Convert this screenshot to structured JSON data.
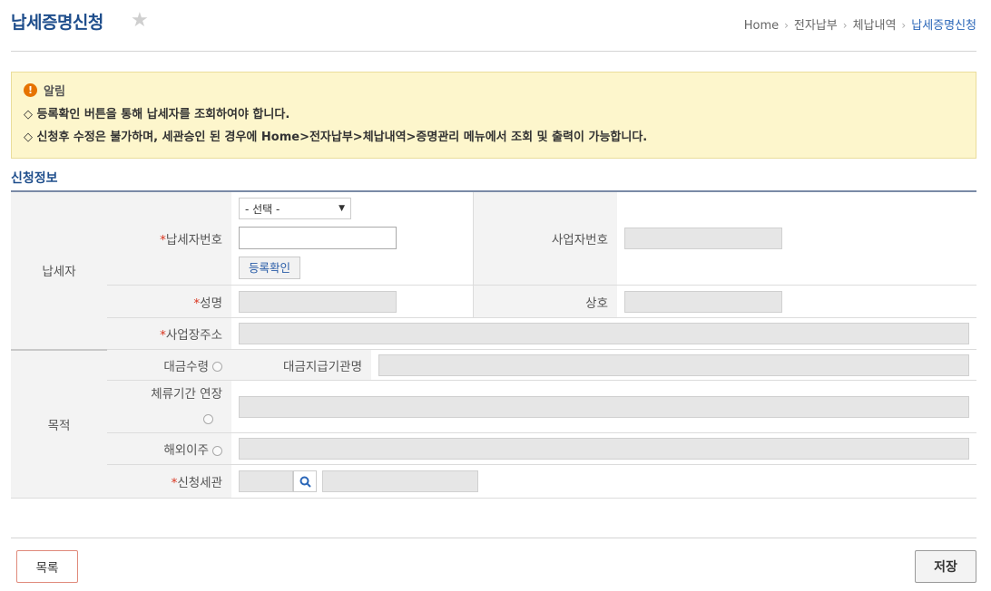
{
  "header": {
    "title": "납세증명신청",
    "breadcrumb": [
      "Home",
      "전자납부",
      "체납내역",
      "납세증명신청"
    ]
  },
  "notice": {
    "head": "알림",
    "lines": [
      "◇ 등록확인 버튼을 통해 납세자를 조회하여야 합니다.",
      "◇ 신청후 수정은 불가하며, 세관승인 된 경우에 Home>전자납부>체납내역>증명관리 메뉴에서 조회 및 출력이 가능합니다."
    ]
  },
  "section_title": "신청정보",
  "form": {
    "group_taxpayer": "납세자",
    "group_purpose": "목적",
    "taxpayer_no": {
      "label": "납세자번호",
      "select_value": "- 선택 -",
      "input_value": "",
      "check_button": "등록확인"
    },
    "business_no": {
      "label": "사업자번호",
      "value": ""
    },
    "name": {
      "label": "성명",
      "value": ""
    },
    "company": {
      "label": "상호",
      "value": ""
    },
    "address": {
      "label": "사업장주소",
      "value": ""
    },
    "purpose_payment": {
      "label": "대금수령",
      "agency_label": "대금지급기관명",
      "agency_value": ""
    },
    "purpose_stay": {
      "label": "체류기간 연장",
      "value": ""
    },
    "purpose_emigration": {
      "label": "해외이주",
      "value": ""
    },
    "customs_office": {
      "label": "신청세관",
      "code": "",
      "name": ""
    }
  },
  "buttons": {
    "list": "목록",
    "save": "저장"
  },
  "colors": {
    "title": "#1f4e8c",
    "required": "#d9341e",
    "notice_bg": "#fdf6cc"
  }
}
